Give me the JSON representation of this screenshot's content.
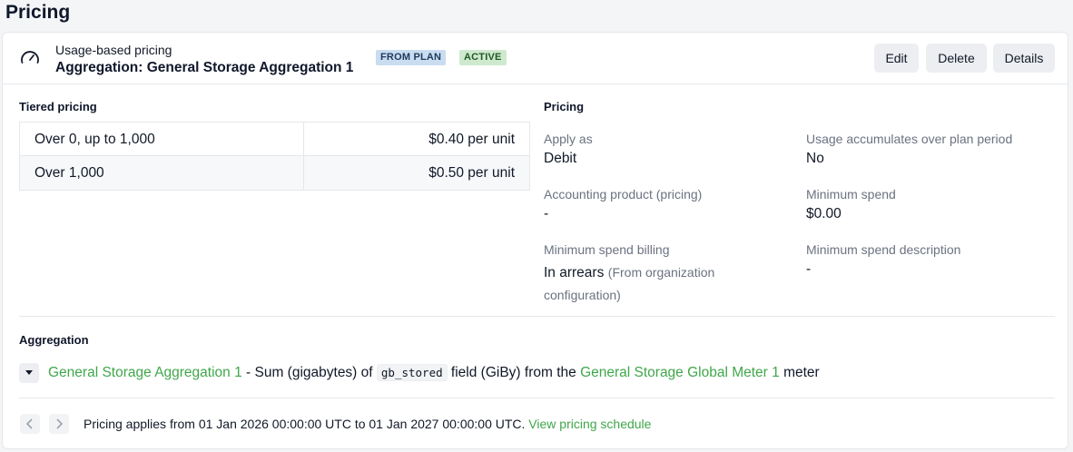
{
  "page": {
    "title": "Pricing"
  },
  "header": {
    "subtitle": "Usage-based pricing",
    "title": "Aggregation: General Storage Aggregation 1",
    "badges": {
      "plan": "FROM PLAN",
      "active": "ACTIVE"
    },
    "buttons": {
      "edit": "Edit",
      "delete": "Delete",
      "details": "Details"
    },
    "icon": "gauge-icon"
  },
  "tiered": {
    "label": "Tiered pricing",
    "rows": [
      {
        "range": "Over 0, up to 1,000",
        "price": "$0.40 per unit"
      },
      {
        "range": "Over 1,000",
        "price": "$0.50 per unit"
      }
    ]
  },
  "pricing": {
    "label": "Pricing",
    "apply_as": {
      "label": "Apply as",
      "value": "Debit"
    },
    "usage_accumulates": {
      "label": "Usage accumulates over plan period",
      "value": "No"
    },
    "accounting_product": {
      "label": "Accounting product (pricing)",
      "value": "-"
    },
    "minimum_spend": {
      "label": "Minimum spend",
      "value": "$0.00"
    },
    "minimum_spend_billing": {
      "label": "Minimum spend billing",
      "value": "In arrears",
      "note": "(From organization configuration)"
    },
    "minimum_spend_description": {
      "label": "Minimum spend description",
      "value": "-"
    }
  },
  "aggregation": {
    "label": "Aggregation",
    "name": "General Storage Aggregation 1",
    "text_1": " - Sum (gigabytes) of ",
    "field": "gb_stored",
    "text_2": " field (GiBy) from the ",
    "meter": "General Storage Global Meter 1",
    "text_3": " meter"
  },
  "schedule": {
    "text": "Pricing applies from 01 Jan 2026 00:00:00 UTC to 01 Jan 2027 00:00:00 UTC.",
    "link": "View pricing schedule"
  },
  "colors": {
    "link": "#3fa74a",
    "badge_plan_bg": "#c9dcf0",
    "badge_active_bg": "#cfe9cf"
  }
}
